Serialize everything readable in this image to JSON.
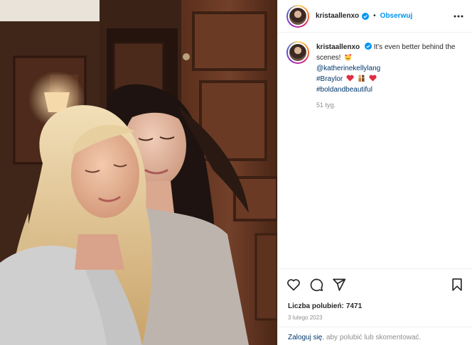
{
  "post": {
    "username": "kristaallenxo",
    "follow_label": "Obserwuj",
    "dot": "•",
    "caption": {
      "text": "It's even better behind the scenes!",
      "mention": "@katherinekellylang",
      "hashtags": [
        "#Braylor",
        "#boldandbeautiful"
      ],
      "time_ago": "51 tyg."
    },
    "likes_label": "Liczba polubień:",
    "likes_count": "7471",
    "date": "3 lutego 2023"
  },
  "footer": {
    "login_link": "Zaloguj się",
    "rest_text": ", aby polubić lub skomentować."
  },
  "icons": {
    "verified": "verified-badge-icon",
    "more": "more-options-icon",
    "like": "heart-outline-icon",
    "comment": "comment-bubble-icon",
    "share": "paper-plane-icon",
    "save": "bookmark-icon"
  },
  "colors": {
    "link": "#00376b",
    "accent": "#0095f6",
    "muted": "#8e8e8e",
    "text": "#262626"
  }
}
